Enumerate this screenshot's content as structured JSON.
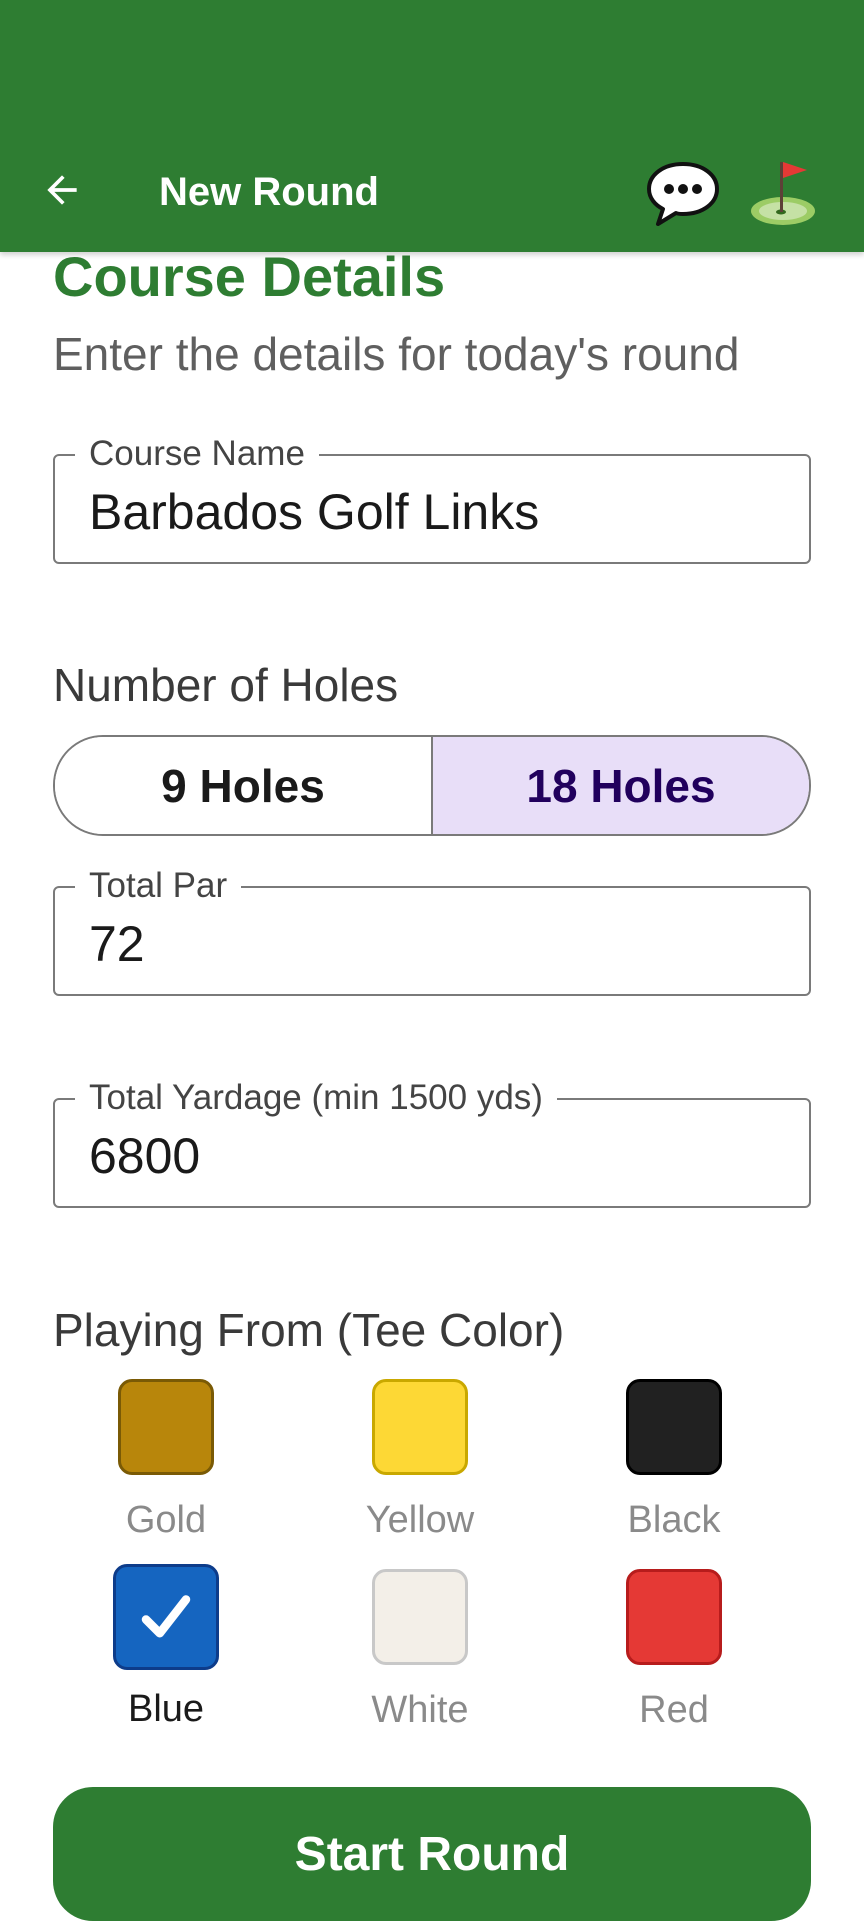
{
  "header": {
    "title": "New Round",
    "back_icon": "arrow-left-icon",
    "chat_icon": "speech-bubble-icon",
    "golf_icon": "golf-flag-icon",
    "background": "#2e7d32"
  },
  "form": {
    "title": "Course Details",
    "subtitle": "Enter the details for today's round",
    "course_name": {
      "label": "Course Name",
      "value": "Barbados Golf Links"
    },
    "holes": {
      "label": "Number of Holes",
      "options": [
        "9 Holes",
        "18 Holes"
      ],
      "selected": "18 Holes"
    },
    "total_par": {
      "label": "Total Par",
      "value": "72"
    },
    "total_yardage": {
      "label": "Total Yardage (min 1500 yds)",
      "value": "6800"
    },
    "tee_color": {
      "label": "Playing From (Tee Color)",
      "options": [
        {
          "name": "Gold",
          "color": "#b8860b",
          "border": "#7a5a05"
        },
        {
          "name": "Yellow",
          "color": "#fdd835",
          "border": "#c9a800"
        },
        {
          "name": "Black",
          "color": "#212121",
          "border": "#000000"
        },
        {
          "name": "Blue",
          "color": "#1565c0",
          "border": "#0d3c8a"
        },
        {
          "name": "White",
          "color": "#f3efe8",
          "border": "#c8c8c8"
        },
        {
          "name": "Red",
          "color": "#e53935",
          "border": "#b71c1c"
        }
      ],
      "selected": "Blue",
      "check_icon": "check-icon"
    }
  },
  "actions": {
    "start_label": "Start Round"
  },
  "colors": {
    "accent": "#2e7d32",
    "segment_selected": "#e8def8"
  }
}
